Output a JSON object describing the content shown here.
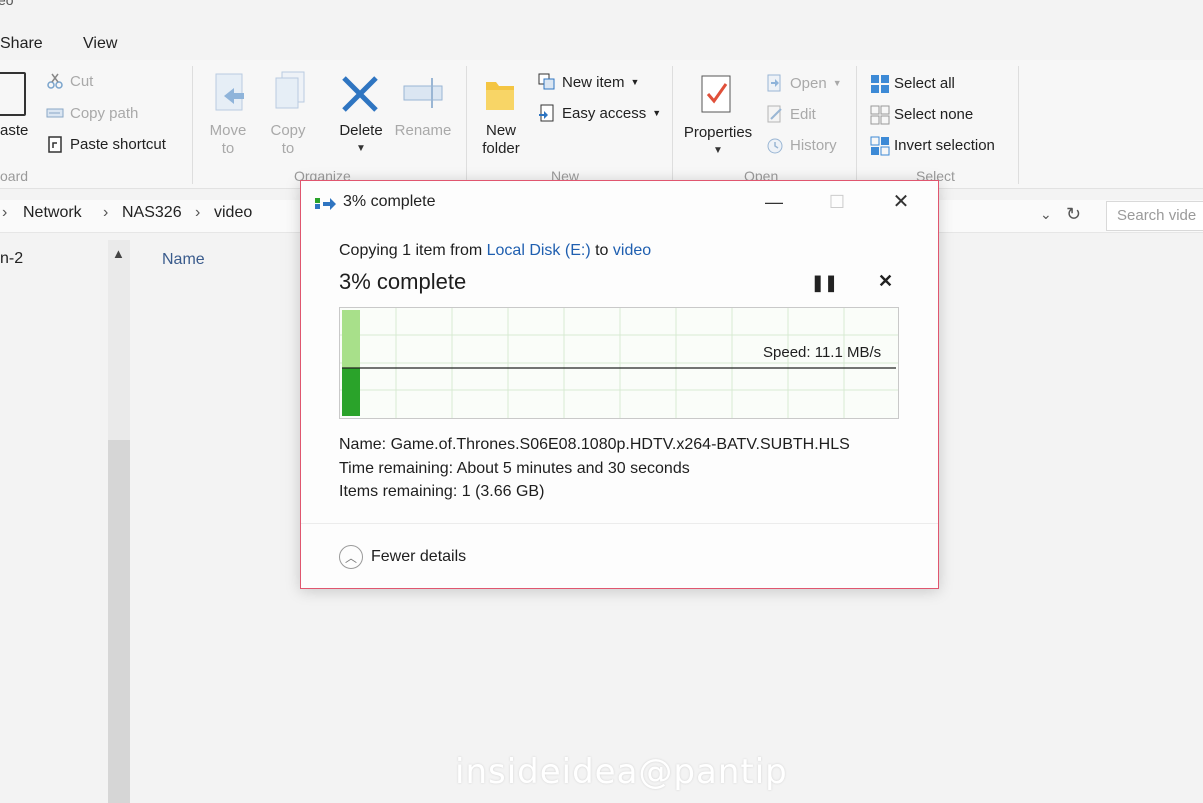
{
  "window": {
    "title_fragment": "eo"
  },
  "tabs": [
    {
      "label": "Share"
    },
    {
      "label": "View"
    }
  ],
  "ribbon": {
    "clipboard": {
      "paste_label": "aste",
      "cut_label": "Cut",
      "copy_path_label": "Copy path",
      "paste_shortcut_label": "Paste shortcut",
      "group_label": "oard"
    },
    "organize": {
      "move_to_line1": "Move",
      "move_to_line2": "to",
      "copy_to_line1": "Copy",
      "copy_to_line2": "to",
      "delete_label": "Delete",
      "rename_label": "Rename",
      "group_label": "Organize"
    },
    "new": {
      "new_folder_line1": "New",
      "new_folder_line2": "folder",
      "new_item_label": "New item",
      "easy_access_label": "Easy access",
      "group_label": "New"
    },
    "open": {
      "properties_label": "Properties",
      "open_label": "Open",
      "edit_label": "Edit",
      "history_label": "History",
      "group_label": "Open"
    },
    "select": {
      "select_all_label": "Select all",
      "select_none_label": "Select none",
      "invert_selection_label": "Invert selection",
      "group_label": "Select"
    }
  },
  "address": {
    "crumbs": [
      "Network",
      "NAS326",
      "video"
    ],
    "search_placeholder": "Search vide"
  },
  "nav_pane": {
    "item_fragment": "n-2"
  },
  "file_list": {
    "name_header": "Name"
  },
  "dialog": {
    "title": "3% complete",
    "copy_prefix": "Copying 1 item from",
    "source": "Local Disk (E:)",
    "to_word": "to",
    "destination": "video",
    "percent_text": "3% complete",
    "progress_fraction": 0.03,
    "speed_label": "Speed: 11.1 MB/s",
    "name_label": "Name:",
    "name_value": "Game.of.Thrones.S06E08.1080p.HDTV.x264-BATV.SUBTH.HLS",
    "time_label": "Time remaining:",
    "time_value": "About 5 minutes and 30 seconds",
    "items_label": "Items remaining:",
    "items_value": "1 (3.66 GB)",
    "fewer_details_label": "Fewer details"
  },
  "colors": {
    "accent": "#1f5fb0",
    "progress_dark": "#2aa32a",
    "progress_light": "#a8e08a",
    "dialog_border": "#e0566f"
  },
  "watermark": "insideidea@pantip"
}
